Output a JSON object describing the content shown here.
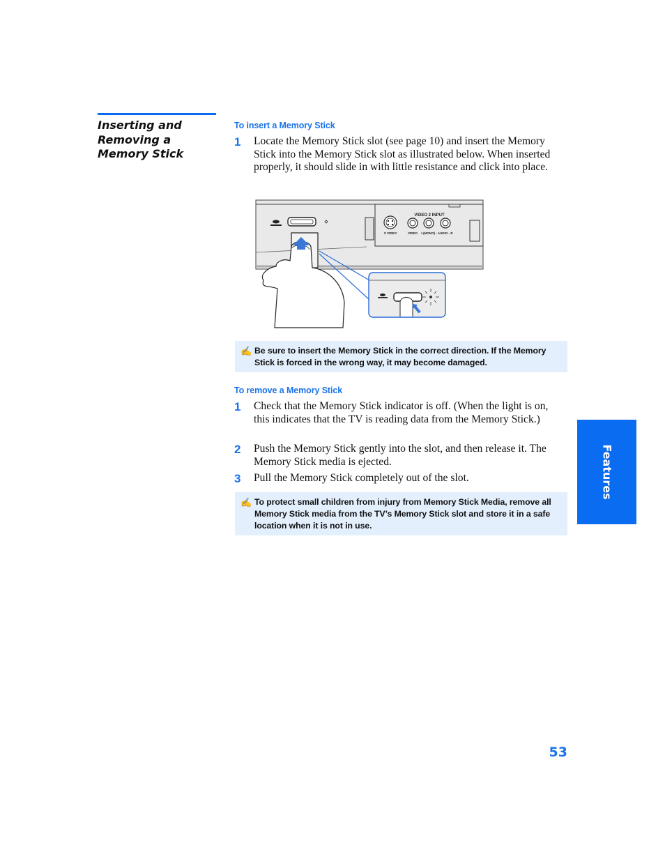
{
  "section": {
    "title_lines": [
      "Inserting and",
      "Removing a",
      "Memory Stick"
    ]
  },
  "insert": {
    "heading": "To insert a Memory Stick",
    "steps": [
      {
        "number": "1",
        "text": "Locate the Memory Stick slot (see page 10) and insert the Memory Stick into the Memory Stick slot as illustrated below. When inserted properly, it should slide in with little resistance and click into place."
      }
    ],
    "illustration": {
      "panel_label": "VIDEO 2 INPUT",
      "jack_labels": [
        "S VIDEO",
        "VIDEO",
        "L(MONO) - AUDIO - R"
      ],
      "logo_label": "MEMORY STICK"
    },
    "note": {
      "icon": "pencil-note-icon",
      "text": "Be sure to insert the Memory Stick in the correct direction. If the Memory Stick is forced in the wrong way, it may become damaged."
    }
  },
  "remove": {
    "heading": "To remove a Memory Stick",
    "steps": [
      {
        "number": "1",
        "text": "Check that the Memory Stick indicator is off. (When the light is on, this indicates that the TV is reading data from the Memory Stick.)"
      },
      {
        "number": "2",
        "text": "Push the Memory Stick gently into the slot, and then release it. The Memory Stick media is ejected."
      },
      {
        "number": "3",
        "text": "Pull the Memory Stick completely out of the slot."
      }
    ],
    "note": {
      "icon": "pencil-note-icon",
      "text": "To protect small children from injury from Memory Stick Media, remove all Memory Stick media from the TV’s Memory Stick slot and store it in a safe location when it is not in use."
    }
  },
  "side_tab": {
    "label": "Features"
  },
  "page_number": "53",
  "colors": {
    "accent": "#0a6cf0",
    "heading_blue": "#1a73e8",
    "note_bg": "#e4effd"
  }
}
